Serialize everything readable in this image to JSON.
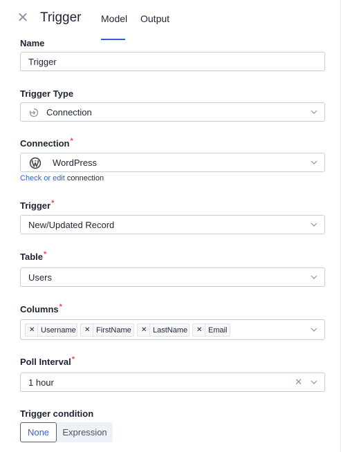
{
  "header": {
    "close_icon": "close-icon",
    "title": "Trigger",
    "tabs": [
      {
        "label": "Model",
        "active": true
      },
      {
        "label": "Output",
        "active": false
      }
    ]
  },
  "name": {
    "label": "Name",
    "value": "Trigger"
  },
  "trigger_type": {
    "label": "Trigger Type",
    "value": "Connection",
    "icon": "connection-icon"
  },
  "connection": {
    "label": "Connection",
    "value": "WordPress",
    "icon": "wordpress-icon",
    "link_text": "Check or edit",
    "link_suffix": "connection"
  },
  "trigger": {
    "label": "Trigger",
    "value": "New/Updated Record"
  },
  "table": {
    "label": "Table",
    "value": "Users"
  },
  "columns": {
    "label": "Columns",
    "tags": [
      "Username",
      "FirstName",
      "LastName",
      "Email"
    ]
  },
  "poll_interval": {
    "label": "Poll Interval",
    "value": "1 hour"
  },
  "trigger_condition": {
    "label": "Trigger condition",
    "options": [
      "None",
      "Expression"
    ],
    "selected": "None"
  },
  "required_mark": "*",
  "colors": {
    "accent": "#2f63d1",
    "required": "#e5484d",
    "border": "#c9ced6"
  }
}
